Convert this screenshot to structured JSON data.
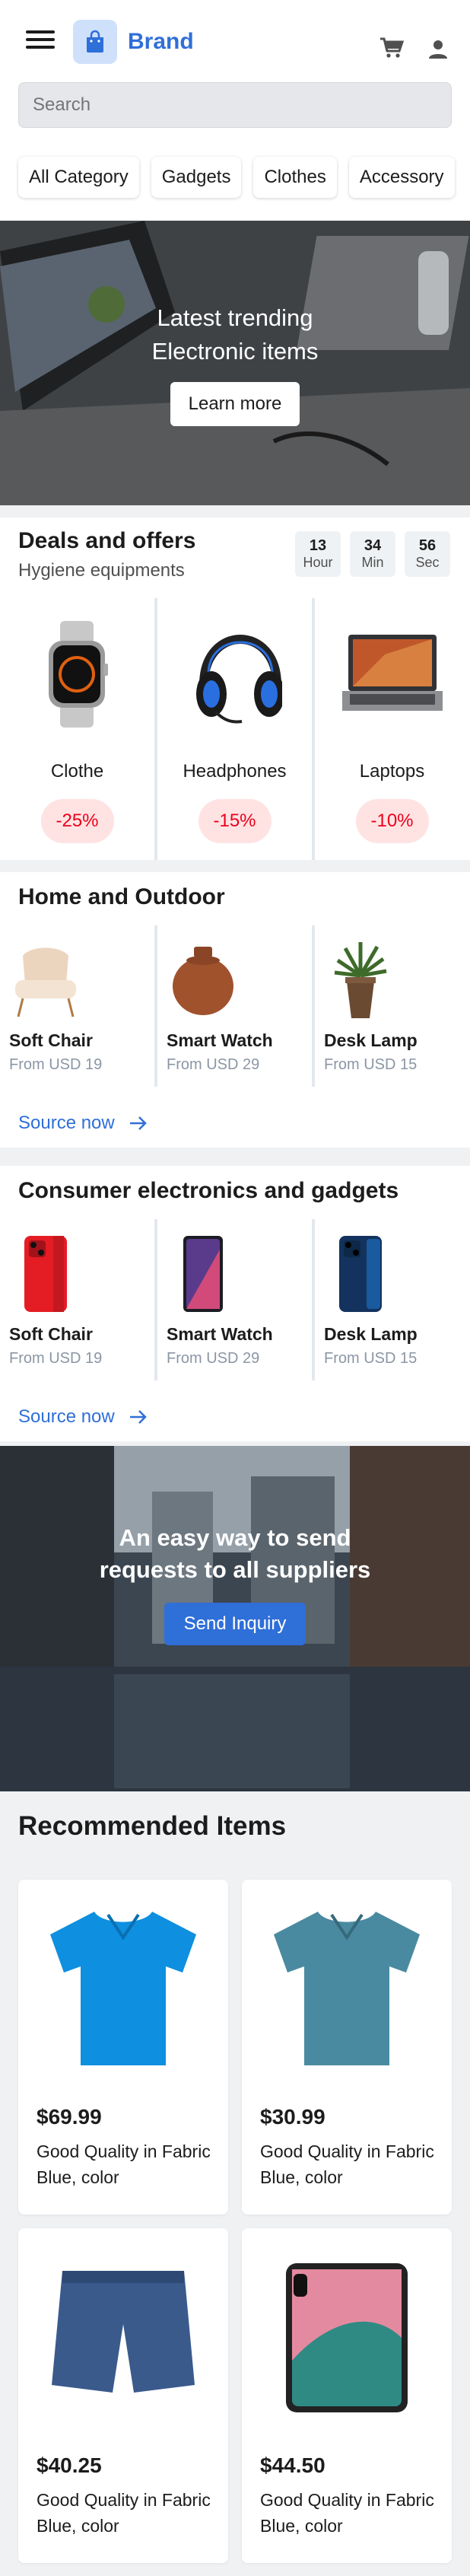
{
  "header": {
    "brand": "Brand",
    "search_placeholder": "Search",
    "categories": [
      "All Category",
      "Gadgets",
      "Clothes",
      "Accessory"
    ]
  },
  "hero": {
    "line1": "Latest trending",
    "line2": "Electronic items",
    "button": "Learn more"
  },
  "deals": {
    "title": "Deals and offers",
    "subtitle": "Hygiene equipments",
    "timer": [
      {
        "num": "13",
        "label": "Hour"
      },
      {
        "num": "34",
        "label": "Min"
      },
      {
        "num": "56",
        "label": "Sec"
      }
    ],
    "items": [
      {
        "name": "Clothe",
        "discount": "-25%"
      },
      {
        "name": "Headphones",
        "discount": "-15%"
      },
      {
        "name": "Laptops",
        "discount": "-10%"
      }
    ]
  },
  "home_outdoor": {
    "title": "Home and Outdoor",
    "items": [
      {
        "name": "Soft Chair",
        "price": "From USD 19"
      },
      {
        "name": "Smart Watch",
        "price": "From USD 29"
      },
      {
        "name": "Desk Lamp",
        "price": "From USD 15"
      }
    ],
    "link": "Source now"
  },
  "electronics": {
    "title": "Consumer electronics and gadgets",
    "items": [
      {
        "name": "Soft Chair",
        "price": "From USD 19"
      },
      {
        "name": "Smart Watch",
        "price": "From USD 29"
      },
      {
        "name": "Desk Lamp",
        "price": "From USD 15"
      }
    ],
    "link": "Source now"
  },
  "inquiry": {
    "line1": "An easy way to send",
    "line2": "requests to all suppliers",
    "button": "Send Inquiry"
  },
  "recommended": {
    "title": "Recommended Items",
    "items": [
      {
        "price": "$69.99",
        "line1": "Good Quality in Fabric",
        "line2": "Blue, color"
      },
      {
        "price": "$30.99",
        "line1": "Good Quality in Fabric",
        "line2": "Blue, color"
      },
      {
        "price": "$40.25",
        "line1": "Good Quality in Fabric",
        "line2": "Blue, color"
      },
      {
        "price": "$44.50",
        "line1": "Good Quality in Fabric",
        "line2": "Blue, color"
      }
    ]
  },
  "colors": {
    "brand": "#2f6fd8",
    "discount": "#eb001b",
    "badge_bg": "#ffe3e3"
  }
}
